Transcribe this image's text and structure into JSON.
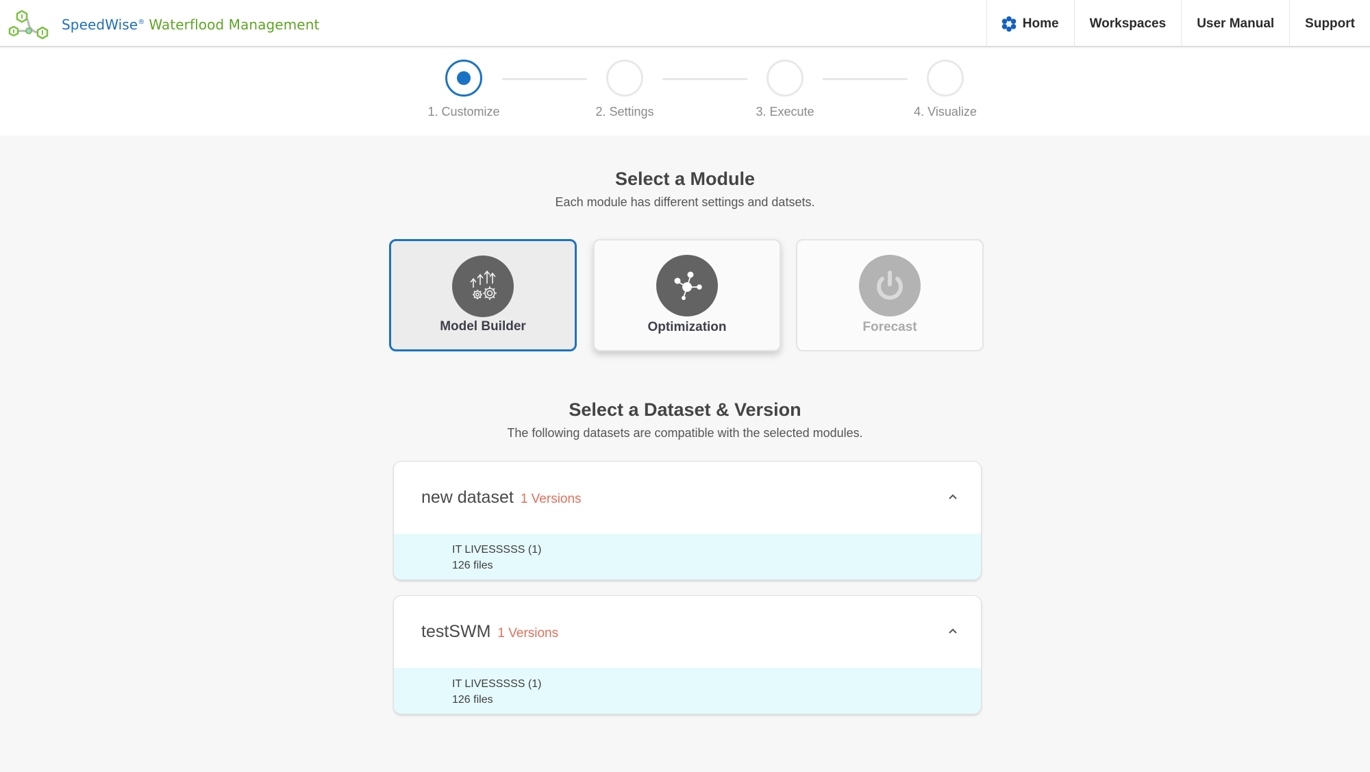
{
  "header": {
    "brand_primary": "SpeedWise",
    "brand_registered": "®",
    "brand_product": "Waterflood Management",
    "logo_icon": "hexagon-network-logo-icon",
    "nav": [
      {
        "label": "Home",
        "icon": "home-flower-icon"
      },
      {
        "label": "Workspaces"
      },
      {
        "label": "User Manual"
      },
      {
        "label": "Support"
      }
    ]
  },
  "stepper": {
    "active_index": 0,
    "steps": [
      {
        "label": "1. Customize",
        "state": "active"
      },
      {
        "label": "2. Settings",
        "state": "pending"
      },
      {
        "label": "3. Execute",
        "state": "pending"
      },
      {
        "label": "4. Visualize",
        "state": "pending"
      }
    ]
  },
  "module_section": {
    "title": "Select a Module",
    "subtitle": "Each module has different settings and datsets.",
    "modules": [
      {
        "label": "Model Builder",
        "icon": "arrows-gears-icon",
        "state": "selected"
      },
      {
        "label": "Optimization",
        "icon": "network-nodes-icon",
        "state": "available"
      },
      {
        "label": "Forecast",
        "icon": "power-icon",
        "state": "disabled"
      }
    ]
  },
  "dataset_section": {
    "title": "Select a Dataset & Version",
    "subtitle": "The following datasets are compatible with the selected modules.",
    "datasets": [
      {
        "name": "new dataset",
        "versions_label": "1 Versions",
        "expanded": true,
        "versions": [
          {
            "name": "IT LIVESSSSS (1)",
            "files": "126 files"
          }
        ]
      },
      {
        "name": "testSWM",
        "versions_label": "1 Versions",
        "expanded": true,
        "versions": [
          {
            "name": "IT LIVESSSSS (1)",
            "files": "126 files"
          }
        ]
      }
    ]
  },
  "colors": {
    "accent_blue": "#1a73c4",
    "brand_green": "#5ea524",
    "versions_orange": "#e0705a",
    "version_row_bg": "#e5fafd"
  }
}
